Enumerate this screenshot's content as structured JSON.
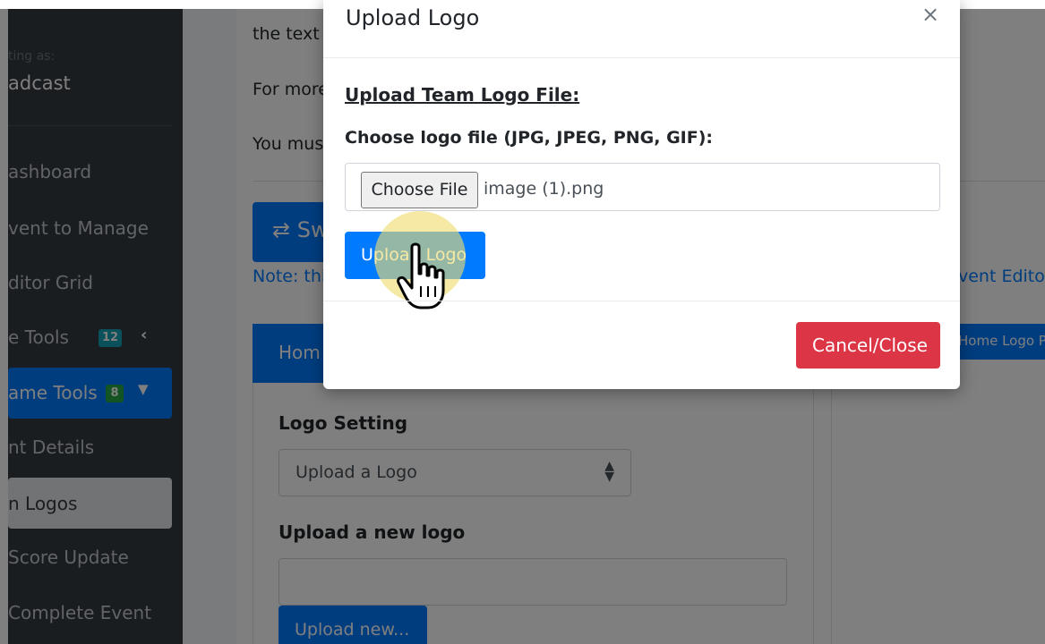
{
  "sidebar": {
    "user_caption": "ting as:",
    "user_name": "adcast",
    "items": [
      {
        "label": "ashboard"
      },
      {
        "label": "vent to Manage"
      },
      {
        "label": "ditor Grid"
      },
      {
        "label": "e Tools",
        "badge": "12"
      },
      {
        "label": "ame Tools",
        "badge": "8"
      },
      {
        "label": "nt Details"
      },
      {
        "label": "n Logos"
      },
      {
        "label": "Score Update"
      },
      {
        "label": "Complete Event"
      }
    ]
  },
  "page": {
    "text_line1": "the text",
    "text_line2": "For more",
    "text_line3": "You mus",
    "swap_button": "⇄ Sw",
    "note_text": "Note: thi",
    "event_editor_text": "vent Edito",
    "home_button_right": "Home Logo P",
    "card_header": "Hom",
    "logo_setting_label": "Logo Setting",
    "logo_setting_value": "Upload a Logo",
    "upload_new_label": "Upload a new logo",
    "upload_new_button": "Upload new..."
  },
  "modal": {
    "title": "Upload Logo",
    "close": "×",
    "heading": "Upload Team Logo File:",
    "file_label": "Choose logo file (JPG, JPEG, PNG, GIF):",
    "choose_button": "Choose File",
    "file_name": "image (1).png",
    "upload_button": "Upload Logo",
    "cancel_button": "Cancel/Close"
  },
  "colors": {
    "primary": "#007bff",
    "danger": "#dc3545",
    "sidebar": "#343a40",
    "badge_info": "#17a2b8",
    "badge_success": "#28a745",
    "highlight": "#f0dc6e"
  }
}
